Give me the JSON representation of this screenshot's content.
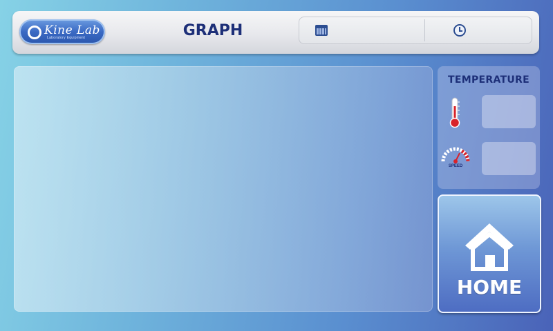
{
  "header": {
    "logo_text": "Kine Lab",
    "logo_tagline": "Laboratory Equipment",
    "title": "GRAPH",
    "date_icon": "calendar-icon",
    "time_icon": "clock-icon"
  },
  "temperature_panel": {
    "title": "TEMPERATURE",
    "thermometer_icon": "thermometer-icon",
    "speed_icon": "speedometer-icon",
    "speed_label": "SPEED"
  },
  "home_button": {
    "label": "HOME",
    "icon": "house-icon"
  },
  "colors": {
    "title_navy": "#1d2f78",
    "accent_red": "#d8232a",
    "background_start": "#86d2e6",
    "background_end": "#4a63b8"
  }
}
